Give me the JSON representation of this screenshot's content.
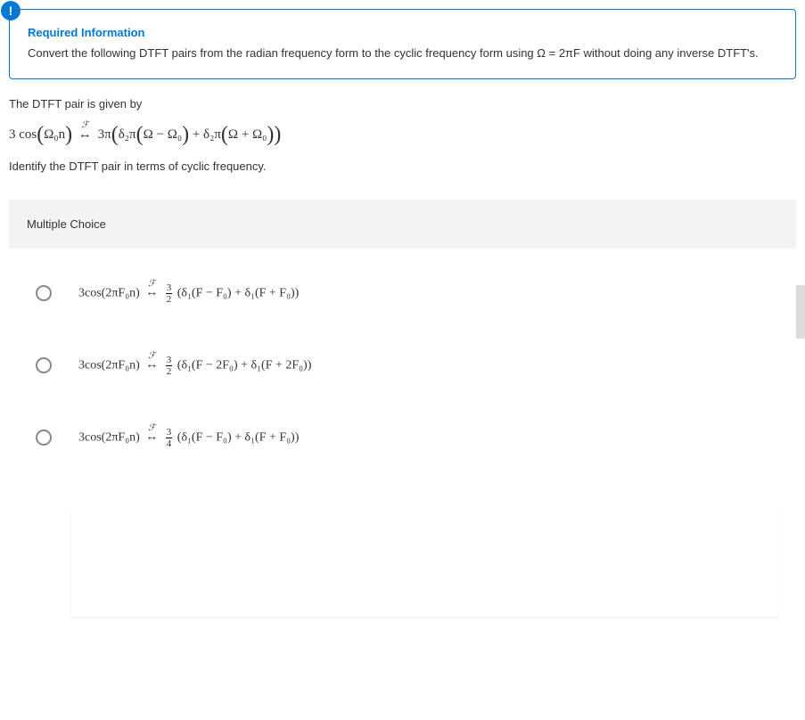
{
  "alertIcon": "!",
  "requiredTitle": "Required Information",
  "requiredDescPrefix": "Convert the following DTFT pairs from the radian frequency form to the cyclic frequency form using ",
  "requiredDescOmega": "Ω = 2πF",
  "requiredDescSuffix": " without doing any inverse DTFT's.",
  "givenLine": "The DTFT pair is given by",
  "mainFormula": {
    "lhs": "3 cos",
    "arg": "Ω₀n",
    "rhs_lead": "3π",
    "delta1": "δ₂π",
    "term1_inner": "Ω − Ω₀",
    "plus": " + ",
    "delta2": "δ₂π",
    "term2_inner": "Ω + Ω₀"
  },
  "identifyLine": "Identify the DTFT pair in terms of cyclic frequency.",
  "mcTitle": "Multiple Choice",
  "choices": [
    {
      "lhs": "3cos",
      "arg": "2πF₀n",
      "frac_num": "3",
      "frac_den": "2",
      "body": "(δ₁(F − F₀) + δ₁(F + F₀))"
    },
    {
      "lhs": "3cos",
      "arg": "2πF₀n",
      "frac_num": "3",
      "frac_den": "2",
      "body_open": "(",
      "d1": "δ₁",
      "t1": "F − 2F₀",
      "plus": " + ",
      "d2": "δ₁",
      "t2": "F + 2F₀",
      "body_close": ")"
    },
    {
      "lhs": "3cos",
      "arg": "2πF₀n",
      "frac_num": "3",
      "frac_den": "4",
      "body_open": "(",
      "d1": "δ₁",
      "t1": "F − F₀",
      "plus": " + ",
      "d2": "δ₁",
      "t2": "F + F₀",
      "body_close": ")"
    }
  ]
}
